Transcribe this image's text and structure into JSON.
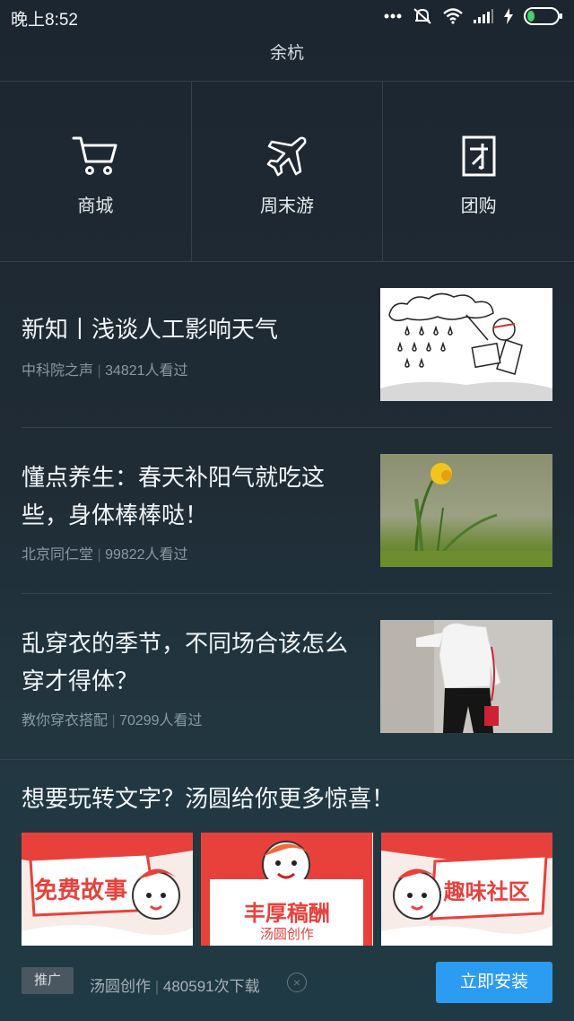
{
  "status_bar": {
    "time": "晚上8:52",
    "icons": [
      "more-icon",
      "mute-icon",
      "wifi-icon",
      "signal-icon",
      "charging-icon",
      "battery-icon"
    ]
  },
  "header": {
    "title": "余杭"
  },
  "quick_entries": [
    {
      "label": "商城",
      "icon": "cart-icon"
    },
    {
      "label": "周末游",
      "icon": "plane-icon"
    },
    {
      "label": "团购",
      "icon": "group-buy-icon"
    }
  ],
  "news": [
    {
      "title": "新知丨浅谈人工影响天气",
      "source": "中科院之声",
      "views": "34821人看过",
      "image": "cartoon-rain-illustration"
    },
    {
      "title": "懂点养生：春天补阳气就吃这些，身体棒棒哒！",
      "source": "北京同仁堂",
      "views": "99822人看过",
      "image": "daffodil-photo"
    },
    {
      "title": "乱穿衣的季节，不同场合该怎么穿才得体？",
      "source": "教你穿衣搭配",
      "views": "70299人看过",
      "image": "fashion-photo"
    }
  ],
  "promo": {
    "title": "想要玩转文字？汤圆给你更多惊喜！",
    "banners": [
      {
        "text": "免费故事"
      },
      {
        "text": "丰厚稿酬",
        "subtext": "汤圆创作"
      },
      {
        "text": "趣味社区"
      }
    ],
    "ad": {
      "tag": "推广",
      "app_name": "汤圆创作",
      "downloads": "480591次下载",
      "install_label": "立即安装"
    }
  },
  "colors": {
    "accent": "#2b9cf2",
    "banner_red": "#e8413c",
    "background": "#1f2b35"
  }
}
